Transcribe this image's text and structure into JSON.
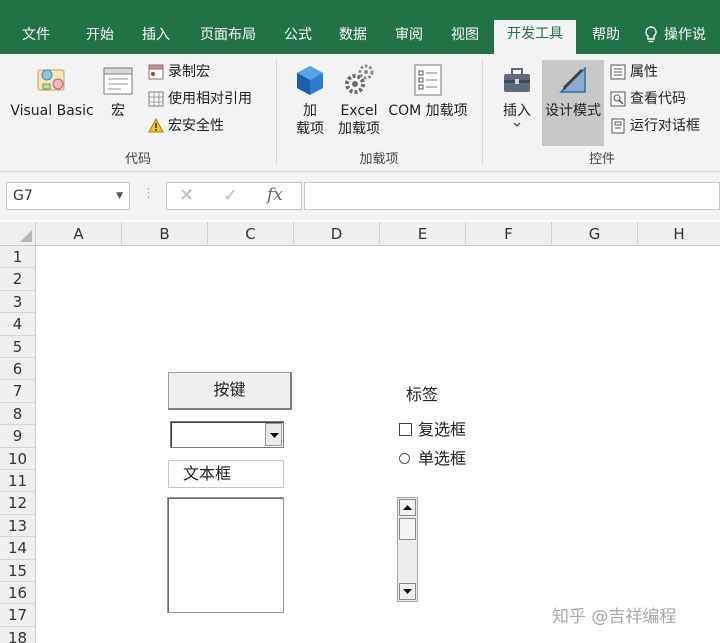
{
  "tabs": [
    {
      "label": "文件"
    },
    {
      "label": "开始"
    },
    {
      "label": "插入"
    },
    {
      "label": "页面布局"
    },
    {
      "label": "公式"
    },
    {
      "label": "数据"
    },
    {
      "label": "审阅"
    },
    {
      "label": "视图"
    },
    {
      "label": "开发工具",
      "active": true
    },
    {
      "label": "帮助"
    },
    {
      "label": "操作说"
    }
  ],
  "ribbon": {
    "code_group": {
      "label": "代码",
      "visual_basic": "Visual Basic",
      "macro": "宏",
      "record_macro": "录制宏",
      "relative_ref": "使用相对引用",
      "macro_security": "宏安全性"
    },
    "addins_group": {
      "label": "加载项",
      "addins_line1": "加",
      "addins_line2": "载项",
      "excel_line1": "Excel",
      "excel_line2": "加载项",
      "com_addins": "COM 加载项"
    },
    "controls_group": {
      "label": "控件",
      "insert": "插入",
      "design_mode": "设计模式",
      "properties": "属性",
      "view_code": "查看代码",
      "run_dialog": "运行对话框"
    }
  },
  "formula_bar": {
    "name_box": "G7",
    "cancel_symbol": "✕",
    "enter_symbol": "✓",
    "fx_label": "fx",
    "value": ""
  },
  "sheet": {
    "columns": [
      "A",
      "B",
      "C",
      "D",
      "E",
      "F",
      "G",
      "H"
    ],
    "rows": [
      "1",
      "2",
      "3",
      "4",
      "5",
      "6",
      "7",
      "8",
      "9",
      "10",
      "11",
      "12",
      "13",
      "14",
      "15",
      "16",
      "17",
      "18"
    ]
  },
  "controls": {
    "button_label": "按键",
    "textbox_value": "文本框",
    "label_text": "标签",
    "checkbox_label": "复选框",
    "radio_label": "单选框"
  },
  "watermark": "知乎 @吉祥编程",
  "colors": {
    "excel_green": "#217346",
    "ribbon_bg": "#f3f3f3",
    "pressed": "#c8c8c8"
  }
}
